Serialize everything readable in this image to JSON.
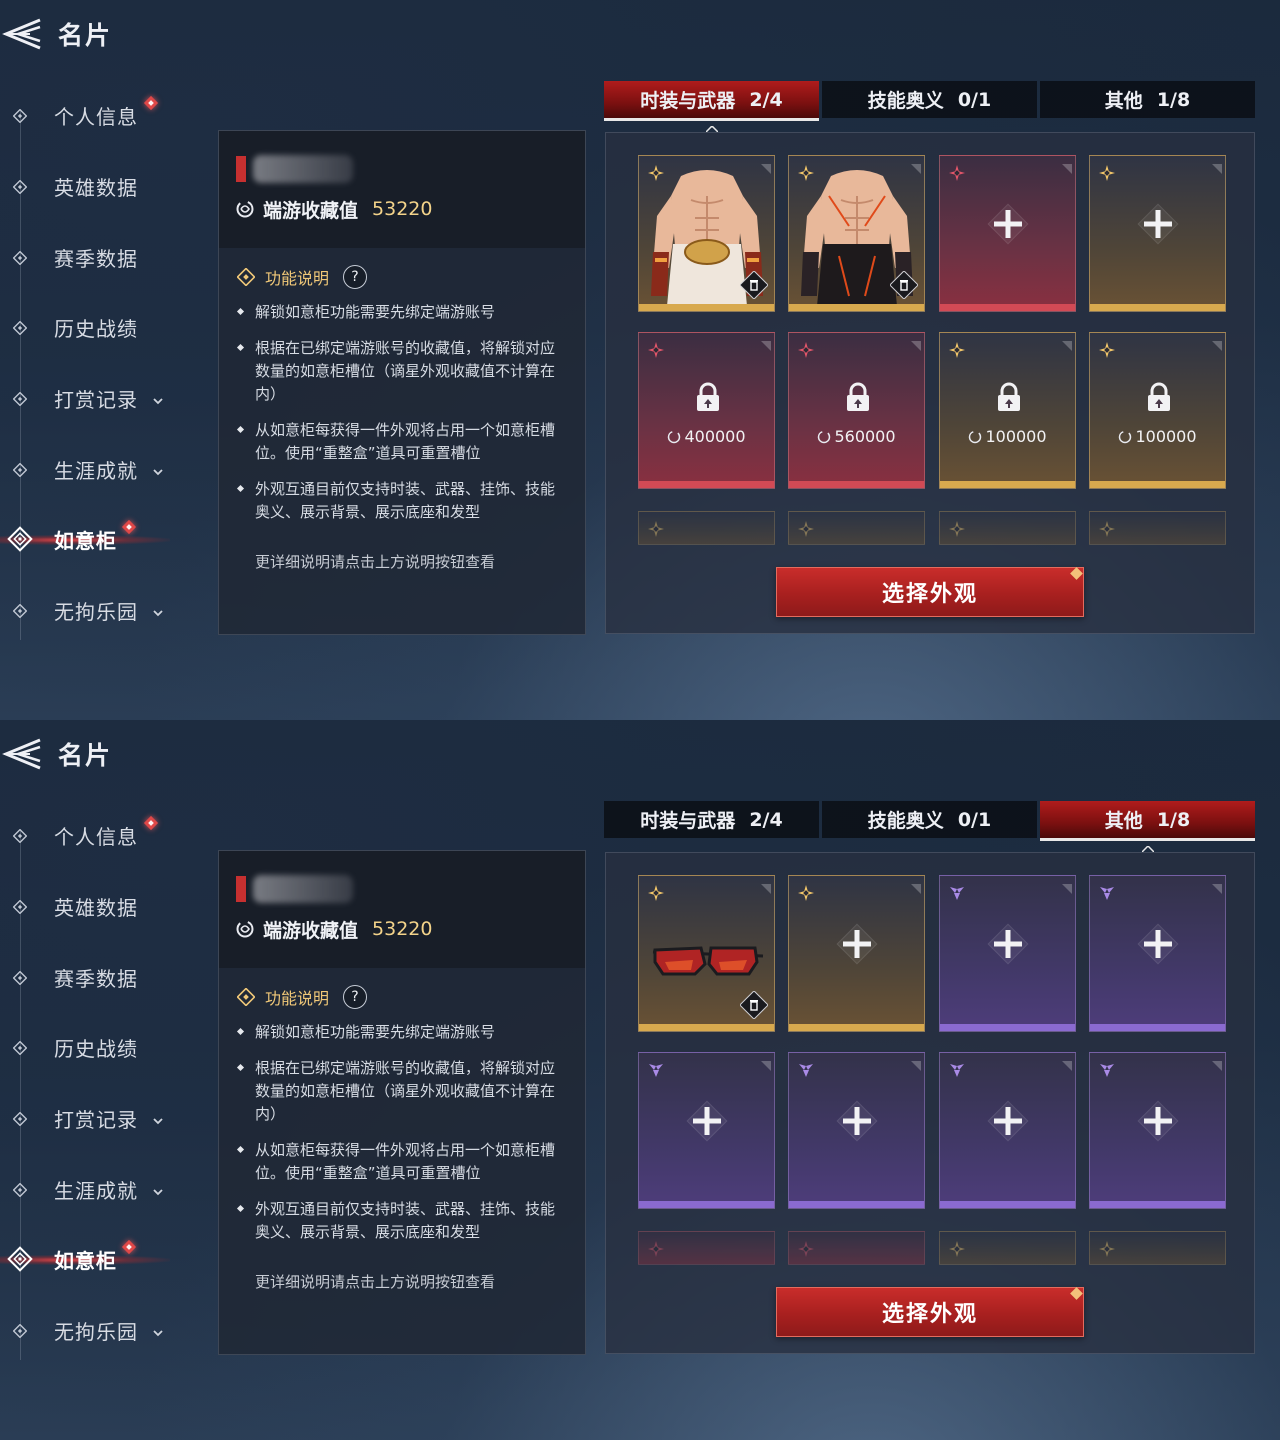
{
  "screens": [
    {
      "title": "名片",
      "nav": [
        {
          "label": "个人信息",
          "has_dot": true,
          "has_chevron": false,
          "active": false
        },
        {
          "label": "英雄数据",
          "has_dot": false,
          "has_chevron": false,
          "active": false
        },
        {
          "label": "赛季数据",
          "has_dot": false,
          "has_chevron": false,
          "active": false
        },
        {
          "label": "历史战绩",
          "has_dot": false,
          "has_chevron": false,
          "active": false
        },
        {
          "label": "打赏记录",
          "has_dot": false,
          "has_chevron": true,
          "active": false
        },
        {
          "label": "生涯成就",
          "has_dot": false,
          "has_chevron": true,
          "active": false
        },
        {
          "label": "如意柜",
          "has_dot": true,
          "has_chevron": false,
          "active": true
        },
        {
          "label": "无拘乐园",
          "has_dot": false,
          "has_chevron": true,
          "active": false
        }
      ],
      "info": {
        "collection_label": "端游收藏值",
        "collection_value": "53220",
        "func_title": "功能说明",
        "help": "?",
        "bullets": [
          "解锁如意柜功能需要先绑定端游账号",
          "根据在已绑定端游账号的收藏值，将解锁对应数量的如意柜槽位（谪星外观收藏值不计算在内）",
          "从如意柜每获得一件外观将占用一个如意柜槽位。使用“重整盒”道具可重置槽位",
          "外观互通目前仅支持时装、武器、挂饰、技能奥义、展示背景、展示底座和发型"
        ],
        "more": "更详细说明请点击上方说明按钮查看"
      },
      "tabs": [
        {
          "label": "时装与武器",
          "count": "2/4",
          "active": true
        },
        {
          "label": "技能奥义",
          "count": "0/1",
          "active": false
        },
        {
          "label": "其他",
          "count": "1/8",
          "active": false
        }
      ],
      "slots": [
        {
          "rarity": "gold",
          "state": "filled",
          "art": "armor-icon"
        },
        {
          "rarity": "gold",
          "state": "filled",
          "art": "dark-armor-icon"
        },
        {
          "rarity": "red",
          "state": "empty"
        },
        {
          "rarity": "gold",
          "state": "empty"
        },
        {
          "rarity": "red",
          "state": "locked",
          "price": "400000"
        },
        {
          "rarity": "red",
          "state": "locked",
          "price": "560000"
        },
        {
          "rarity": "gold",
          "state": "locked",
          "price": "100000"
        },
        {
          "rarity": "gold",
          "state": "locked",
          "price": "100000"
        }
      ],
      "peek": [
        "gold",
        "gold",
        "gold",
        "gold"
      ],
      "select_label": "选择外观"
    },
    {
      "title": "名片",
      "nav": [
        {
          "label": "个人信息",
          "has_dot": true,
          "has_chevron": false,
          "active": false
        },
        {
          "label": "英雄数据",
          "has_dot": false,
          "has_chevron": false,
          "active": false
        },
        {
          "label": "赛季数据",
          "has_dot": false,
          "has_chevron": false,
          "active": false
        },
        {
          "label": "历史战绩",
          "has_dot": false,
          "has_chevron": false,
          "active": false
        },
        {
          "label": "打赏记录",
          "has_dot": false,
          "has_chevron": true,
          "active": false
        },
        {
          "label": "生涯成就",
          "has_dot": false,
          "has_chevron": true,
          "active": false
        },
        {
          "label": "如意柜",
          "has_dot": true,
          "has_chevron": false,
          "active": true
        },
        {
          "label": "无拘乐园",
          "has_dot": false,
          "has_chevron": true,
          "active": false
        }
      ],
      "info": {
        "collection_label": "端游收藏值",
        "collection_value": "53220",
        "func_title": "功能说明",
        "help": "?",
        "bullets": [
          "解锁如意柜功能需要先绑定端游账号",
          "根据在已绑定端游账号的收藏值，将解锁对应数量的如意柜槽位（谪星外观收藏值不计算在内）",
          "从如意柜每获得一件外观将占用一个如意柜槽位。使用“重整盒”道具可重置槽位",
          "外观互通目前仅支持时装、武器、挂饰、技能奥义、展示背景、展示底座和发型"
        ],
        "more": "更详细说明请点击上方说明按钮查看"
      },
      "tabs": [
        {
          "label": "时装与武器",
          "count": "2/4",
          "active": false
        },
        {
          "label": "技能奥义",
          "count": "0/1",
          "active": false
        },
        {
          "label": "其他",
          "count": "1/8",
          "active": true
        }
      ],
      "slots": [
        {
          "rarity": "gold",
          "state": "filled",
          "art": "sunglasses-icon"
        },
        {
          "rarity": "gold",
          "state": "empty"
        },
        {
          "rarity": "purple",
          "state": "empty"
        },
        {
          "rarity": "purple",
          "state": "empty"
        },
        {
          "rarity": "purple",
          "state": "empty"
        },
        {
          "rarity": "purple",
          "state": "empty"
        },
        {
          "rarity": "purple",
          "state": "empty"
        },
        {
          "rarity": "purple",
          "state": "empty"
        }
      ],
      "peek": [
        "red",
        "red",
        "gold",
        "gold"
      ],
      "select_label": "选择外观"
    }
  ],
  "colors": {
    "accent_red": "#c92d2b",
    "gold_text": "#f3d38a",
    "func_title": "#f0c878",
    "rarity_gold": "#d8a94e",
    "rarity_red": "#d24a55",
    "rarity_purple": "#8a6ad0"
  }
}
